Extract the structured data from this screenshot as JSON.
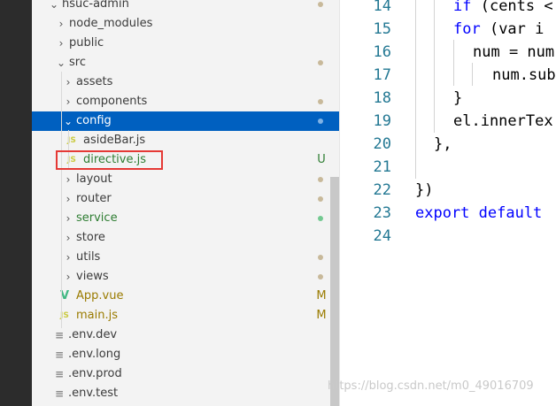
{
  "explorer": {
    "items": [
      {
        "label": "hsuc-admin",
        "chevron": "⌄",
        "icon": null,
        "badge": "",
        "dot": "#c8b99a"
      },
      {
        "label": "node_modules",
        "chevron": "›",
        "icon": null,
        "badge": "",
        "dot": null
      },
      {
        "label": "public",
        "chevron": "›",
        "icon": null,
        "badge": "",
        "dot": null
      },
      {
        "label": "src",
        "chevron": "⌄",
        "icon": null,
        "badge": "",
        "dot": "#c8b99a"
      },
      {
        "label": "assets",
        "chevron": "›",
        "icon": null,
        "badge": "",
        "dot": null
      },
      {
        "label": "components",
        "chevron": "›",
        "icon": null,
        "badge": "",
        "dot": "#c8b99a"
      },
      {
        "label": "config",
        "chevron": "⌄",
        "icon": null,
        "badge": "",
        "dot": "#7fb2e5"
      },
      {
        "label": "asideBar.js",
        "chevron": null,
        "icon": "JS",
        "badge": "",
        "dot": null
      },
      {
        "label": "directive.js",
        "chevron": null,
        "icon": "JS",
        "badge": "U",
        "dot": null
      },
      {
        "label": "layout",
        "chevron": "›",
        "icon": null,
        "badge": "",
        "dot": "#c8b99a"
      },
      {
        "label": "router",
        "chevron": "›",
        "icon": null,
        "badge": "",
        "dot": "#c8b99a"
      },
      {
        "label": "service",
        "chevron": "›",
        "icon": null,
        "badge": "",
        "dot": "#73c991"
      },
      {
        "label": "store",
        "chevron": "›",
        "icon": null,
        "badge": "",
        "dot": null
      },
      {
        "label": "utils",
        "chevron": "›",
        "icon": null,
        "badge": "",
        "dot": "#c8b99a"
      },
      {
        "label": "views",
        "chevron": "›",
        "icon": null,
        "badge": "",
        "dot": "#c8b99a"
      },
      {
        "label": "App.vue",
        "chevron": null,
        "icon": "V",
        "badge": "M",
        "dot": null
      },
      {
        "label": "main.js",
        "chevron": null,
        "icon": "JS",
        "badge": "M",
        "dot": null
      },
      {
        "label": ".env.dev",
        "chevron": null,
        "icon": "≡",
        "badge": "",
        "dot": null
      },
      {
        "label": ".env.long",
        "chevron": null,
        "icon": "≡",
        "badge": "",
        "dot": null
      },
      {
        "label": ".env.prod",
        "chevron": null,
        "icon": "≡",
        "badge": "",
        "dot": null
      },
      {
        "label": ".env.test",
        "chevron": null,
        "icon": "≡",
        "badge": "",
        "dot": null
      }
    ],
    "selected_index": 6
  },
  "colors": {
    "js_icon": "#cbcb41",
    "vue_icon": "#41b883",
    "untracked": "#2e7d32",
    "modified": "#9a7b00",
    "selection": "#0060c0",
    "highlight_box": "#e53935"
  },
  "editor": {
    "lines": [
      {
        "number": "14",
        "kw": "if",
        "rest": " (cents <"
      },
      {
        "number": "15",
        "kw": "for",
        "rest": " (var i"
      },
      {
        "number": "16",
        "kw": "",
        "rest": "num = num"
      },
      {
        "number": "17",
        "kw": "",
        "rest": "num.sub"
      },
      {
        "number": "18",
        "kw": "",
        "rest": "}"
      },
      {
        "number": "19",
        "kw": "",
        "rest": "el.innerTex"
      },
      {
        "number": "20",
        "kw": "",
        "rest": "},"
      },
      {
        "number": "21",
        "kw": "",
        "rest": ""
      },
      {
        "number": "22",
        "kw": "",
        "rest": "})"
      },
      {
        "number": "23",
        "kw": "export default",
        "rest": ""
      },
      {
        "number": "24",
        "kw": "",
        "rest": ""
      }
    ]
  },
  "watermark": "https://blog.csdn.net/m0_49016709"
}
